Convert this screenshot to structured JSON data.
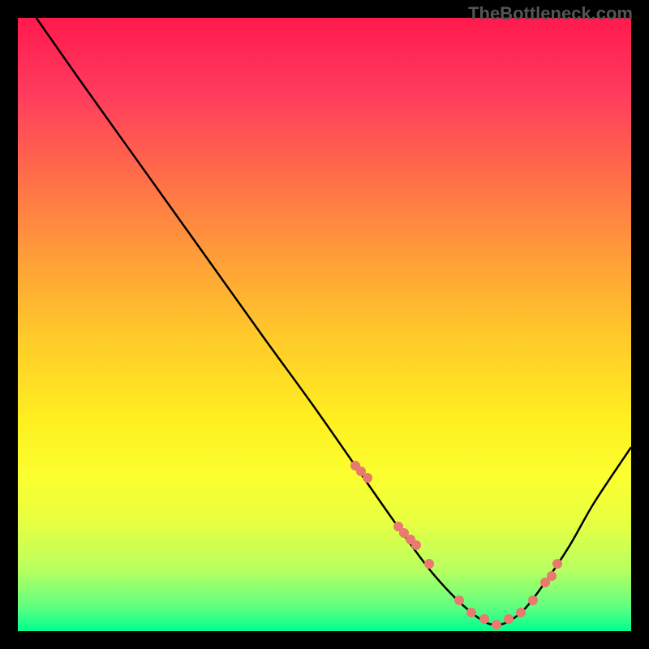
{
  "watermark": "TheBottleneck.com",
  "chart_data": {
    "type": "line",
    "title": "",
    "xlabel": "",
    "ylabel": "",
    "xlim": [
      0,
      100
    ],
    "ylim": [
      0,
      100
    ],
    "series": [
      {
        "name": "bottleneck-curve",
        "x": [
          3,
          10,
          20,
          30,
          40,
          48,
          55,
          62,
          68,
          74,
          78,
          82,
          86,
          90,
          94,
          100
        ],
        "y": [
          100,
          90,
          76,
          62,
          48,
          37,
          27,
          17,
          9,
          3,
          1,
          3,
          8,
          14,
          21,
          30
        ]
      }
    ],
    "markers": {
      "name": "highlight-points",
      "x": [
        55,
        56,
        57,
        62,
        63,
        64,
        65,
        67,
        72,
        74,
        76,
        78,
        80,
        82,
        84,
        86,
        87,
        88
      ],
      "y": [
        27,
        26,
        25,
        17,
        16,
        15,
        14,
        11,
        5,
        3,
        2,
        1,
        2,
        3,
        5,
        8,
        9,
        11
      ]
    },
    "gradient": {
      "top": "#ff1a4d",
      "middle": "#ffd020",
      "bottom": "#00ff90"
    }
  }
}
